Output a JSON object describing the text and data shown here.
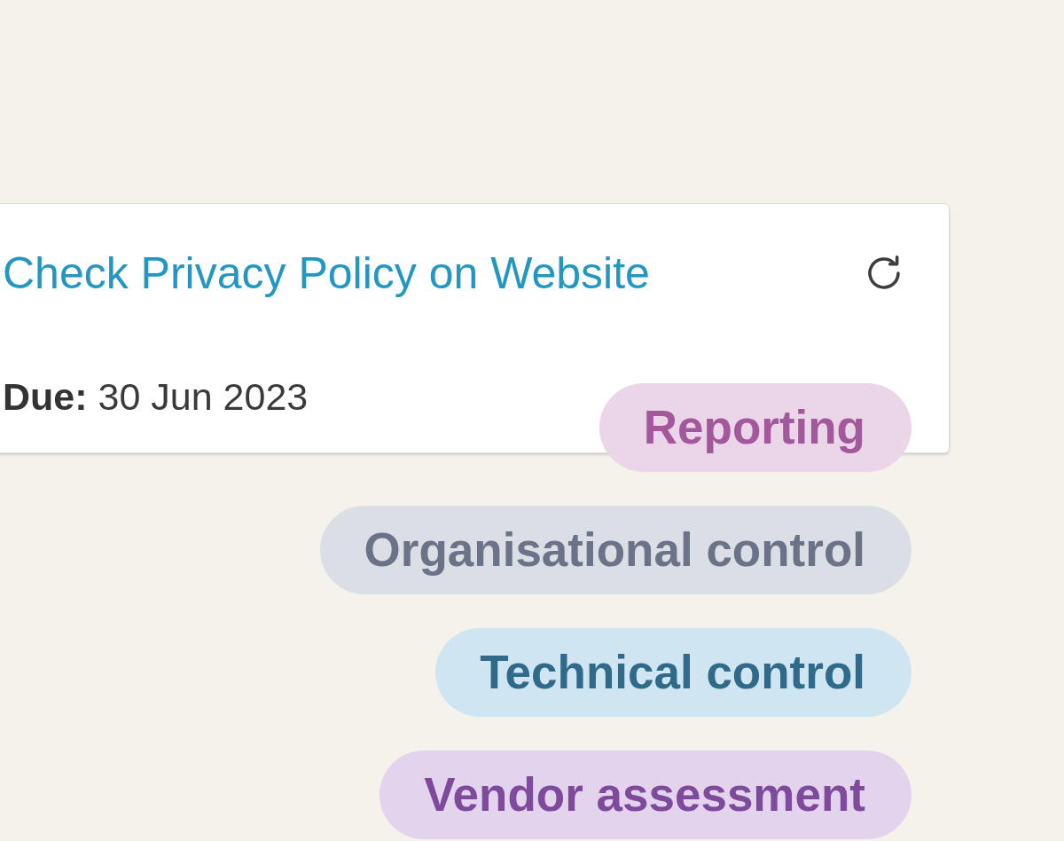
{
  "card": {
    "title": "Check Privacy Policy on Website",
    "due": "**Due:** 30 Jun 2023"
  },
  "tags": [
    {
      "label": "Reporting",
      "color": "#a3589b"
    },
    {
      "label": "Organisational control",
      "color": "#6b7388"
    },
    {
      "label": "Technical control",
      "color": "#306a8a"
    },
    {
      "label": "Vendor assessment",
      "color": "#7e4a9c"
    }
  ]
}
